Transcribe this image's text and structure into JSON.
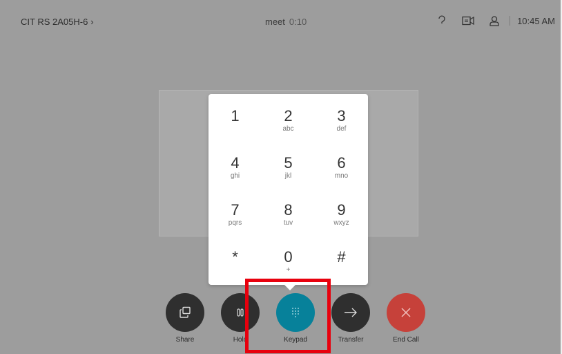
{
  "topbar": {
    "device_name": "CIT RS 2A05H-6",
    "meeting_title": "meet",
    "meeting_timer": "0:10",
    "time": "10:45 AM",
    "icons": [
      "help-icon",
      "self-view-icon",
      "user-icon"
    ]
  },
  "keypad": {
    "keys": [
      {
        "digit": "1",
        "letters": ""
      },
      {
        "digit": "2",
        "letters": "abc"
      },
      {
        "digit": "3",
        "letters": "def"
      },
      {
        "digit": "4",
        "letters": "ghi"
      },
      {
        "digit": "5",
        "letters": "jkl"
      },
      {
        "digit": "6",
        "letters": "mno"
      },
      {
        "digit": "7",
        "letters": "pqrs"
      },
      {
        "digit": "8",
        "letters": "tuv"
      },
      {
        "digit": "9",
        "letters": "wxyz"
      },
      {
        "digit": "*",
        "letters": ""
      },
      {
        "digit": "0",
        "letters": "+"
      },
      {
        "digit": "#",
        "letters": ""
      }
    ]
  },
  "controls": {
    "share": "Share",
    "hold": "Hold",
    "keypad": "Keypad",
    "transfer": "Transfer",
    "end_call": "End Call"
  },
  "colors": {
    "background": "#9d9d9d",
    "keypad_active": "#07819a",
    "end_call": "#c6413a",
    "highlight": "#e8000d"
  }
}
